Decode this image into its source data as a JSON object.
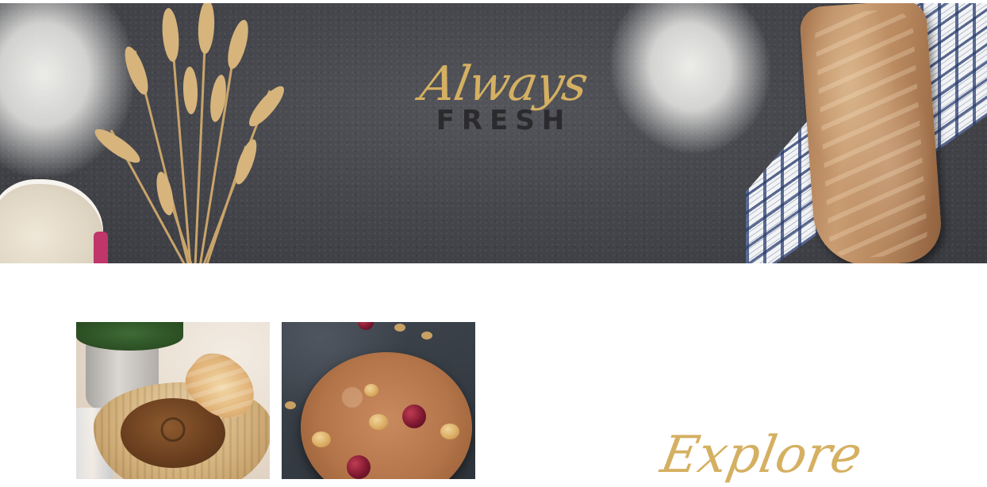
{
  "hero": {
    "script_title": "Always",
    "subtitle": "FRESH",
    "accent_color": "#d5b062",
    "background_color": "#46474c"
  },
  "gallery": {
    "tiles": [
      {
        "name": "bagel-basket-photo",
        "subject": "bagel and croissant in basket"
      },
      {
        "name": "cookie-photo",
        "subject": "nut and cranberry cookie"
      }
    ]
  },
  "explore": {
    "title": "Explore"
  }
}
